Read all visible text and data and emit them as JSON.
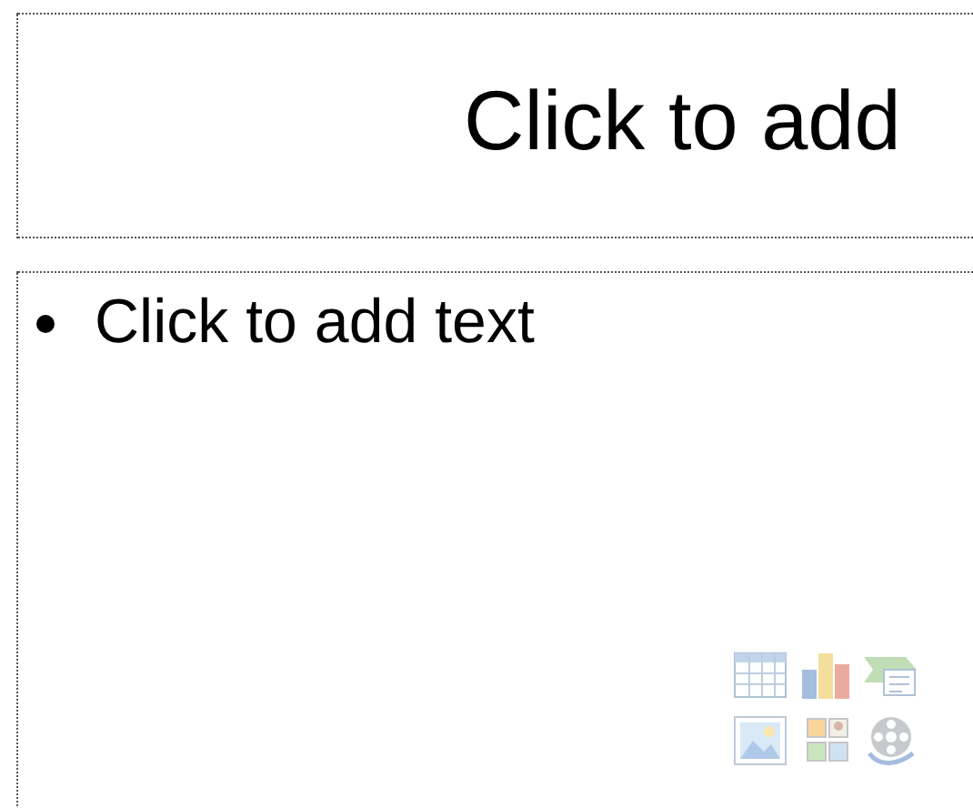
{
  "title_placeholder": {
    "text": "Click to add"
  },
  "content_placeholder": {
    "bullets": [
      {
        "text": "Click to add text"
      }
    ],
    "insert_icons": [
      {
        "kind": "table"
      },
      {
        "kind": "chart"
      },
      {
        "kind": "smartart"
      },
      {
        "kind": "picture"
      },
      {
        "kind": "clipart"
      },
      {
        "kind": "media"
      }
    ]
  }
}
